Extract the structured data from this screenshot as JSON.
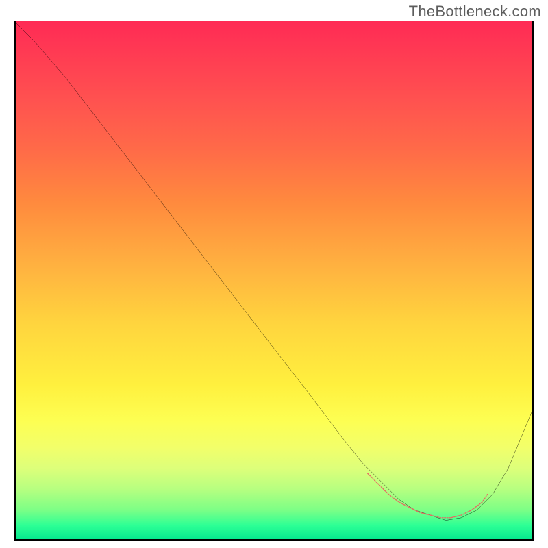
{
  "watermark": "TheBottleneck.com",
  "chart_data": {
    "type": "line",
    "title": "",
    "xlabel": "",
    "ylabel": "",
    "xlim": [
      0,
      100
    ],
    "ylim": [
      0,
      100
    ],
    "series": [
      {
        "name": "bottleneck-curve",
        "x": [
          0,
          4,
          10,
          20,
          30,
          40,
          50,
          57,
          63,
          67,
          71,
          74,
          77,
          80,
          83,
          86,
          89,
          92,
          95,
          100
        ],
        "values": [
          100,
          96,
          89,
          76,
          63,
          50,
          37,
          28,
          20,
          15,
          11,
          8,
          6,
          5,
          4,
          4.5,
          6,
          9,
          14,
          26
        ]
      }
    ],
    "dotted_segment": {
      "name": "optimal-range-markers",
      "note": "salmon dashed overlay near curve minimum",
      "x": [
        68,
        70,
        72,
        74,
        76,
        78,
        80,
        82,
        84,
        86,
        88,
        90,
        91
      ],
      "values": [
        13,
        11,
        9,
        7.5,
        6.5,
        5.5,
        5,
        4.5,
        4.5,
        5,
        6,
        7.5,
        9
      ]
    },
    "colors": {
      "curve": "#000000",
      "markers": "#e66a62",
      "gradient_top": "#ff2a55",
      "gradient_bottom": "#00e58e"
    }
  }
}
